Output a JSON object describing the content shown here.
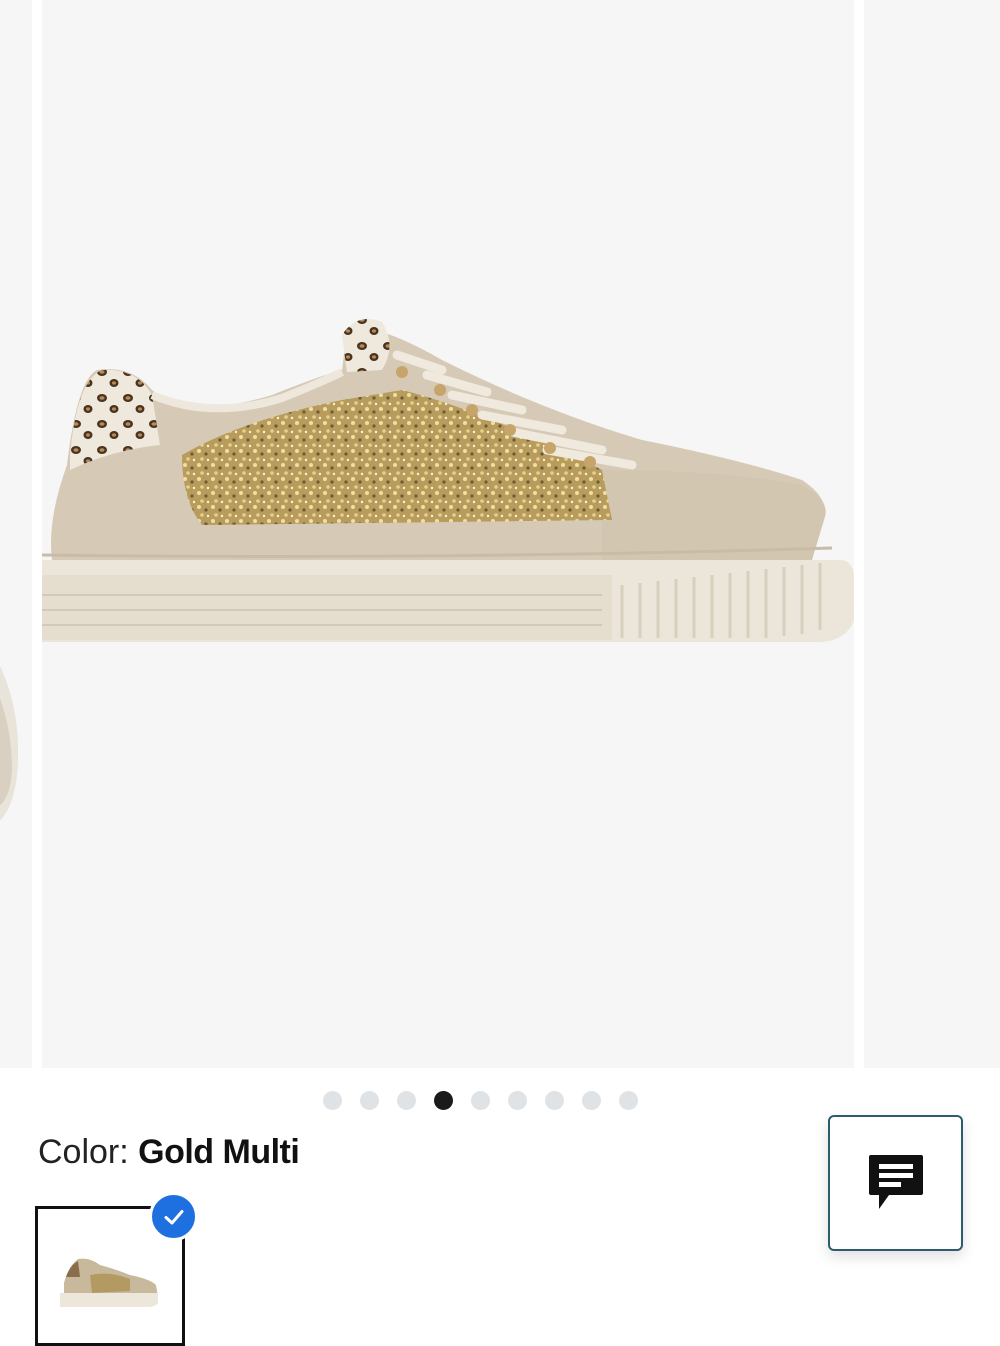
{
  "gallery": {
    "slide_count": 9,
    "active_index": 3,
    "main_image_alt": "gold glitter sneaker"
  },
  "product": {
    "color_label": "Color: ",
    "color_value": "Gold Multi",
    "selected_swatch": "Gold Multi"
  },
  "icons": {
    "chat": "chat-bubble-icon",
    "check": "check-icon"
  },
  "colors": {
    "accent_blue": "#1e6fe0",
    "chat_border": "#2b5d6e",
    "dot_active": "#1a1a1a",
    "dot_inactive": "#dfe3e6",
    "image_background": "#f6f6f6"
  }
}
